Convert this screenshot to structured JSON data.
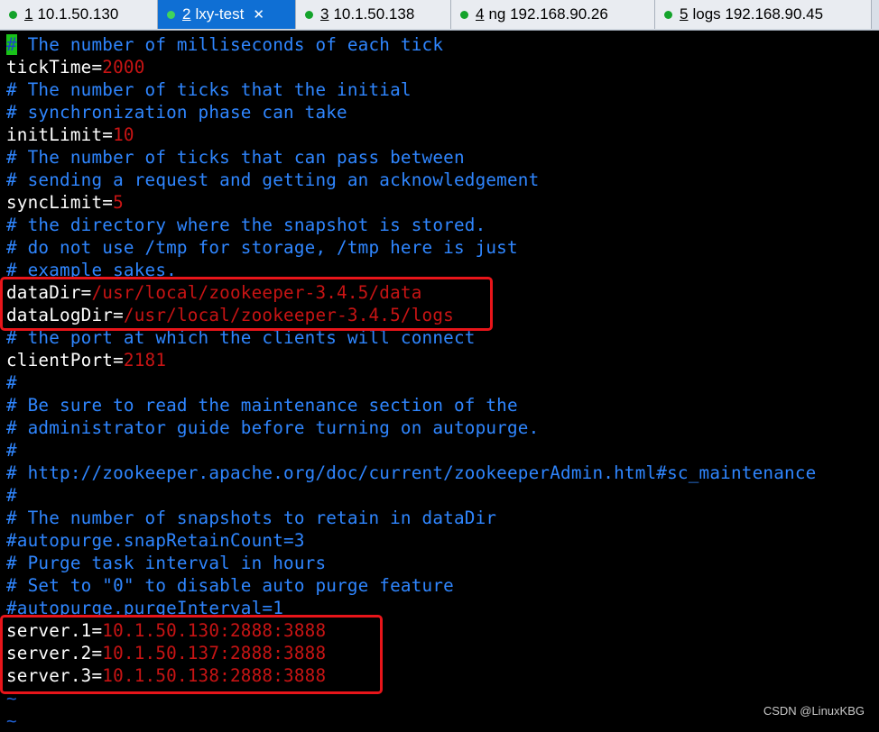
{
  "tabs": [
    {
      "num": "1",
      "label": "10.1.50.130",
      "active": false
    },
    {
      "num": "2",
      "label": "lxy-test",
      "active": true
    },
    {
      "num": "3",
      "label": "10.1.50.138",
      "active": false
    },
    {
      "num": "4",
      "label": "ng 192.168.90.26",
      "active": false
    },
    {
      "num": "5",
      "label": "logs 192.168.90.45",
      "active": false
    }
  ],
  "tab_close_glyph": "✕",
  "lines": [
    {
      "first": "#",
      "comment": " The number of milliseconds of each tick"
    },
    {
      "key": "tickTime=",
      "value": "2000"
    },
    {
      "comment": "# The number of ticks that the initial"
    },
    {
      "comment": "# synchronization phase can take"
    },
    {
      "key": "initLimit=",
      "value": "10"
    },
    {
      "comment": "# The number of ticks that can pass between"
    },
    {
      "comment": "# sending a request and getting an acknowledgement"
    },
    {
      "key": "syncLimit=",
      "value": "5"
    },
    {
      "comment": "# the directory where the snapshot is stored."
    },
    {
      "comment": "# do not use /tmp for storage, /tmp here is just"
    },
    {
      "comment": "# example sakes."
    },
    {
      "key": "dataDir=",
      "value": "/usr/local/zookeeper-3.4.5/data"
    },
    {
      "key": "dataLogDir=",
      "value": "/usr/local/zookeeper-3.4.5/logs"
    },
    {
      "comment": "# the port at which the clients will connect"
    },
    {
      "key": "clientPort=",
      "value": "2181"
    },
    {
      "comment": "#"
    },
    {
      "comment": "# Be sure to read the maintenance section of the"
    },
    {
      "comment": "# administrator guide before turning on autopurge."
    },
    {
      "comment": "#"
    },
    {
      "comment": "# http://zookeeper.apache.org/doc/current/zookeeperAdmin.html#sc_maintenance"
    },
    {
      "comment": "#"
    },
    {
      "comment": "# The number of snapshots to retain in dataDir"
    },
    {
      "comment": "#autopurge.snapRetainCount=3"
    },
    {
      "comment": "# Purge task interval in hours"
    },
    {
      "comment": "# Set to \"0\" to disable auto purge feature"
    },
    {
      "comment": "#autopurge.purgeInterval=1"
    },
    {
      "key": "server.1=",
      "value": "10.1.50.130:2888:3888"
    },
    {
      "key": "server.2=",
      "value": "10.1.50.137:2888:3888"
    },
    {
      "key": "server.3=",
      "value": "10.1.50.138:2888:3888"
    },
    {
      "tilde": "~"
    },
    {
      "tilde": "~"
    }
  ],
  "watermark": "CSDN @LinuxKBG",
  "colors": {
    "comment": "#2f86ff",
    "key": "#ffffff",
    "value": "#c81414",
    "highlight_box": "#e8151a",
    "active_tab": "#0f6fd4"
  }
}
